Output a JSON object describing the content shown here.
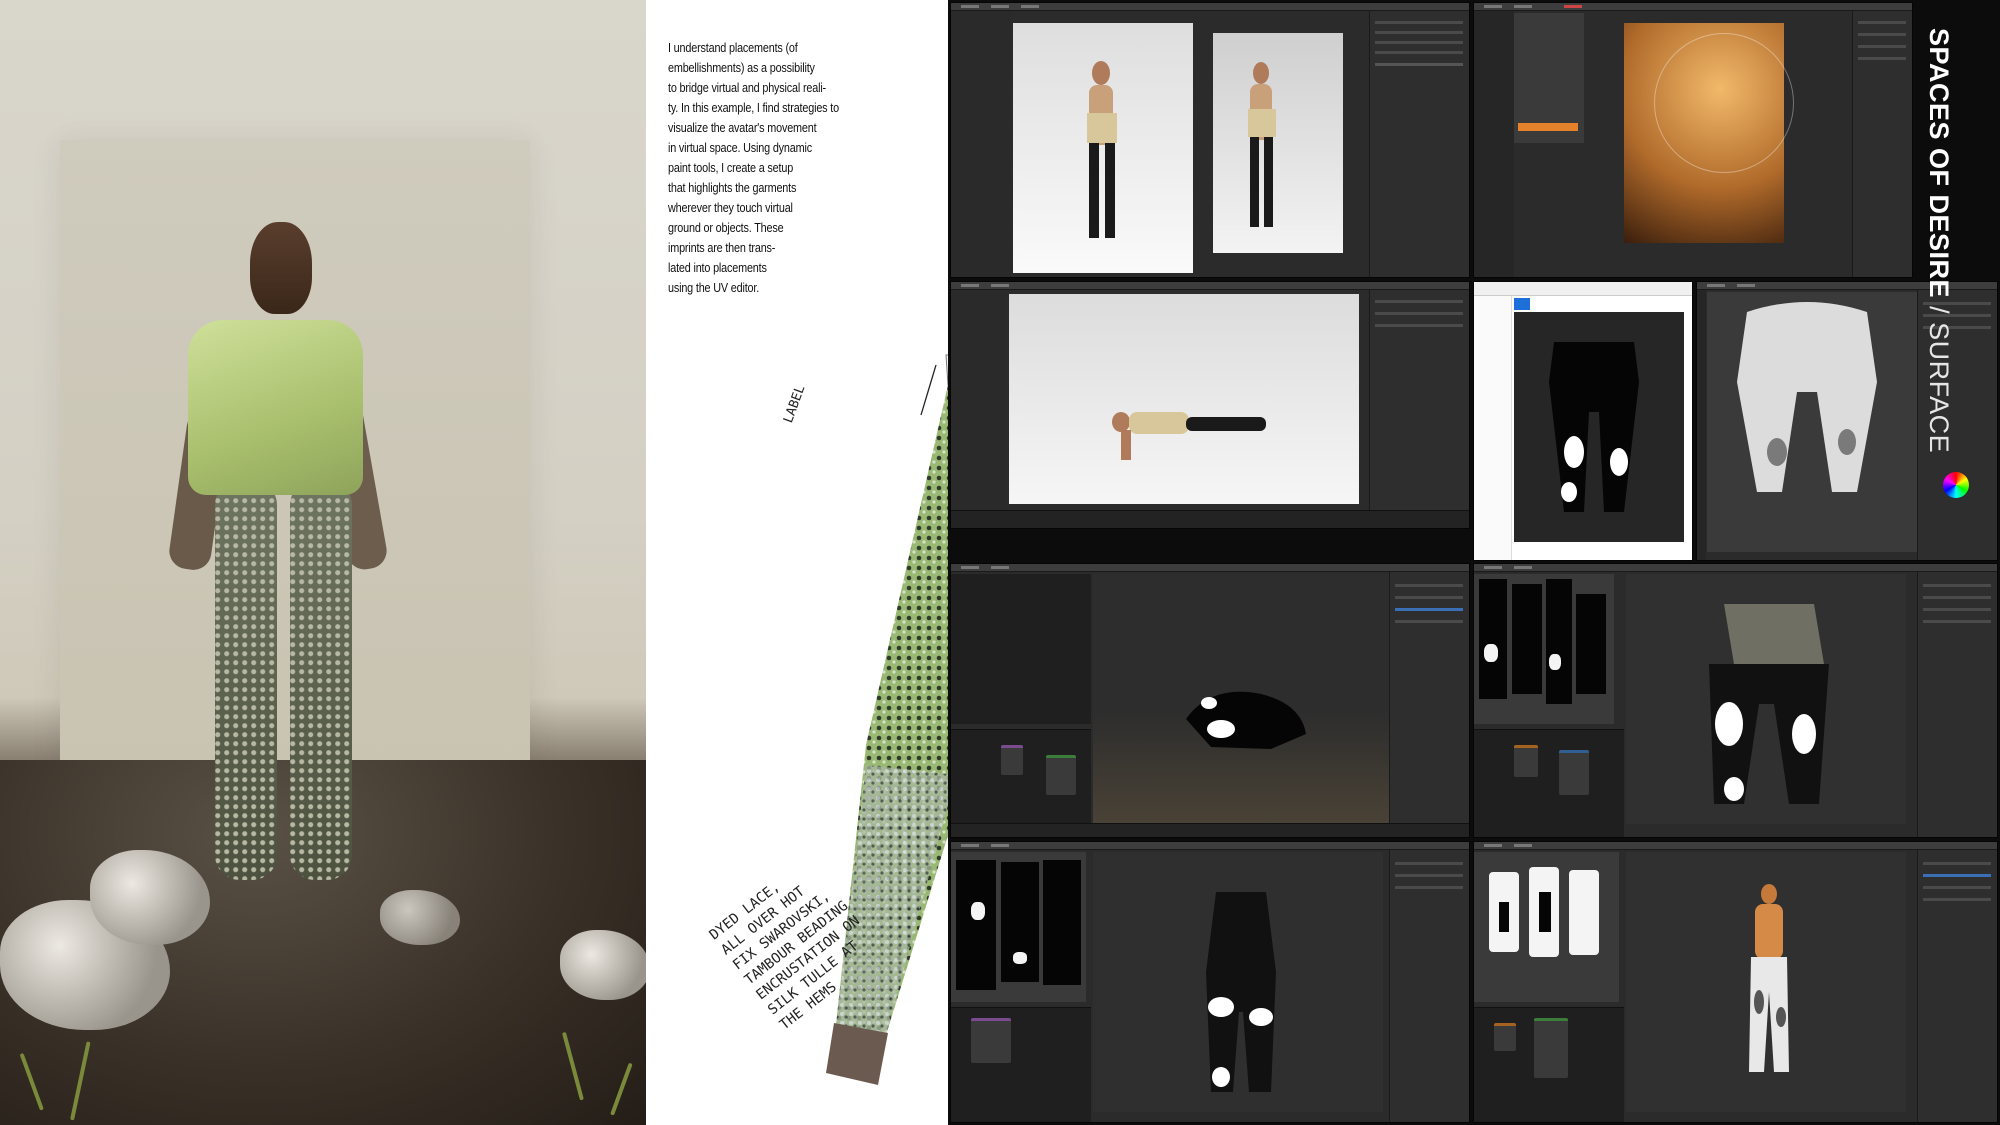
{
  "layout": {
    "width": 2000,
    "height": 1125
  },
  "sketch_panel": {
    "paragraph_lines": [
      "I understand placements (of",
      "embellishments) as a possibility",
      "to bridge virtual and physical reali-",
      "ty. In this example, I find strategies to",
      "visualize the avatar's movement",
      "in virtual space. Using dynamic",
      "paint tools, I create a setup",
      "that highlights the garments",
      "wherever they touch virtual",
      "ground or objects. These",
      "imprints are then trans-",
      "lated into placements",
      "using the UV editor."
    ],
    "label_annotation": "LABEL",
    "handwritten_note_lines": [
      "DYED LACE,",
      "ALL OVER HOT",
      "FIX SWAROVSKI,",
      "TAMBOUR BEADING",
      "ENCRUSTATION ON",
      "SILK TULLE AT",
      "THE HEMS"
    ],
    "colors": {
      "paper": "#ffffff",
      "text": "#111111",
      "pants_green": "#8fae6a",
      "hem_brown": "#6b5a4f"
    }
  },
  "title": {
    "bold_part": "SPACES OF DESIRE",
    "light_part": " / SURFACE",
    "color": "#ffffff"
  },
  "collage": {
    "background": "#0c0c0c",
    "ui_dark": "#2b2b2b",
    "ui_panel": "#2e2e2e",
    "accent_orange": "#e3822b",
    "accent_blue": "#3a6fb5"
  }
}
